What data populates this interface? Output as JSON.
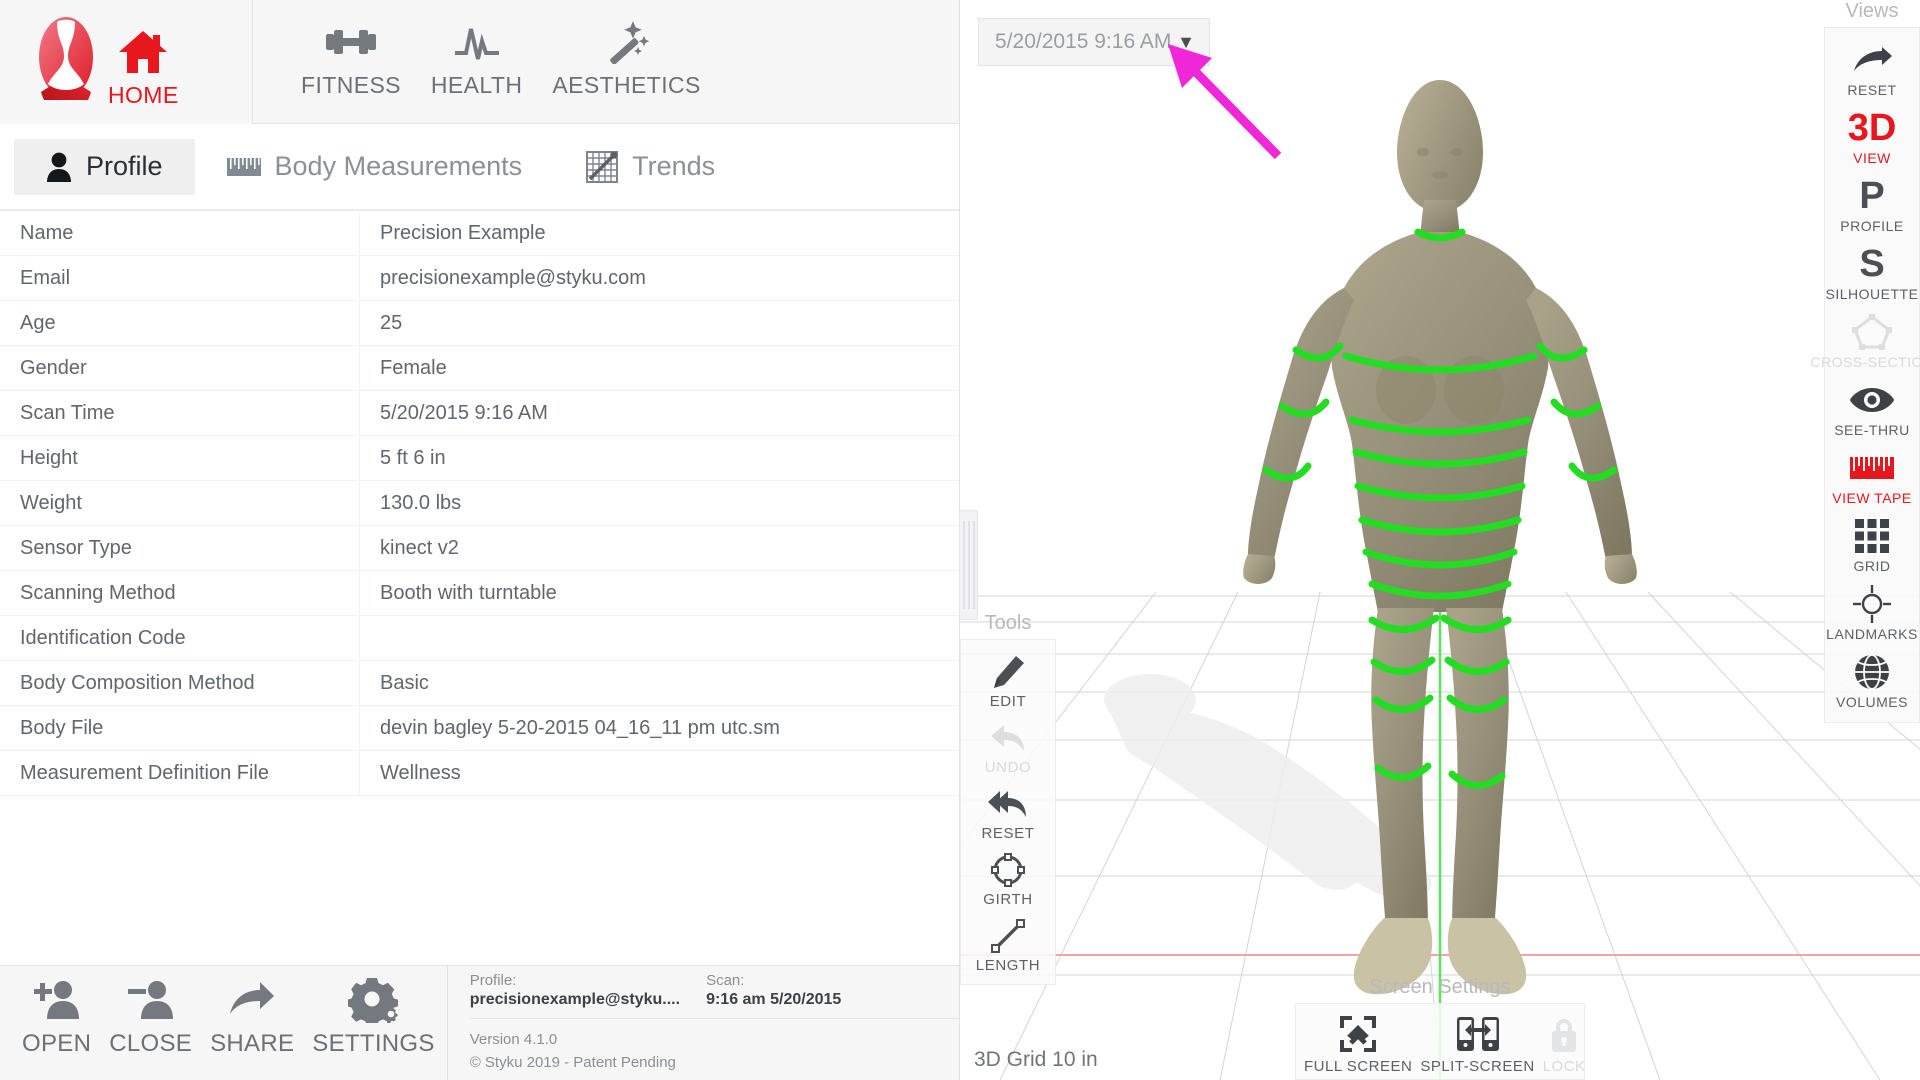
{
  "header": {
    "brand_name": "Styku",
    "logo_icon": "styku-logo-icon",
    "nav": [
      {
        "label": "HOME",
        "icon": "home-icon",
        "active": true
      },
      {
        "label": "FITNESS",
        "icon": "dumbbell-icon",
        "active": false
      },
      {
        "label": "HEALTH",
        "icon": "heartbeat-icon",
        "active": false
      },
      {
        "label": "AESTHETICS",
        "icon": "magic-wand-icon",
        "active": false
      }
    ]
  },
  "tabs": [
    {
      "label": "Profile",
      "icon": "person-icon",
      "active": true
    },
    {
      "label": "Body Measurements",
      "icon": "tape-measure-icon",
      "active": false
    },
    {
      "label": "Trends",
      "icon": "chart-trend-icon",
      "active": false
    }
  ],
  "profile": {
    "rows": [
      {
        "key": "Name",
        "value": "Precision Example"
      },
      {
        "key": "Email",
        "value": "precisionexample@styku.com"
      },
      {
        "key": "Age",
        "value": "25"
      },
      {
        "key": "Gender",
        "value": "Female"
      },
      {
        "key": "Scan Time",
        "value": "5/20/2015 9:16 AM"
      },
      {
        "key": "Height",
        "value": "5 ft 6 in"
      },
      {
        "key": "Weight",
        "value": "130.0 lbs"
      },
      {
        "key": "Sensor Type",
        "value": "kinect v2"
      },
      {
        "key": "Scanning Method",
        "value": "Booth with turntable"
      },
      {
        "key": "Identification Code",
        "value": ""
      },
      {
        "key": "Body Composition Method",
        "value": "Basic"
      },
      {
        "key": "Body File",
        "value": "devin bagley 5-20-2015 04_16_11 pm utc.sm"
      },
      {
        "key": "Measurement Definition File",
        "value": "Wellness"
      }
    ]
  },
  "bottom_bar": {
    "actions": [
      {
        "label": "OPEN",
        "icon": "add-user-icon"
      },
      {
        "label": "CLOSE",
        "icon": "remove-user-icon"
      },
      {
        "label": "SHARE",
        "icon": "share-arrow-icon"
      },
      {
        "label": "SETTINGS",
        "icon": "gear-icon"
      }
    ],
    "profile_label": "Profile:",
    "profile_value": "precisionexample@styku....",
    "scan_label": "Scan:",
    "scan_value": "9:16 am 5/20/2015",
    "version": "Version 4.1.0",
    "copyright": "© Styku 2019 - Patent Pending"
  },
  "viewport": {
    "scan_selector": {
      "value": "5/20/2015 9:16 AM",
      "caret_icon": "chevron-down-icon"
    },
    "grid_label": "3D Grid 10 in",
    "cursor_icon": "mouse-pointer-arrow",
    "cursor_color": "#f026d9",
    "model": {
      "skin_color": "#97907c",
      "band_color": "#22dd22",
      "axis_color": "#53e053",
      "floor_line_color": "#f5a3a3"
    }
  },
  "tools_panel": {
    "title": "Tools",
    "items": [
      {
        "label": "EDIT",
        "icon": "pen-icon",
        "disabled": false
      },
      {
        "label": "UNDO",
        "icon": "undo-arrow-icon",
        "disabled": true
      },
      {
        "label": "RESET",
        "icon": "reset-double-arrow-icon",
        "disabled": false
      },
      {
        "label": "GIRTH",
        "icon": "girth-circle-icon",
        "disabled": false
      },
      {
        "label": "LENGTH",
        "icon": "length-line-icon",
        "disabled": false
      }
    ]
  },
  "views_panel": {
    "title": "Views",
    "items": [
      {
        "label": "RESET",
        "icon": "reset-arrow-icon",
        "accent": false,
        "disabled": false
      },
      {
        "label": "VIEW",
        "icon": "3d-text-icon",
        "glyph": "3D",
        "accent": true,
        "disabled": false
      },
      {
        "label": "PROFILE",
        "icon": "p-letter-icon",
        "glyph": "P",
        "accent": false,
        "disabled": false
      },
      {
        "label": "SILHOUETTE",
        "icon": "s-letter-icon",
        "glyph": "S",
        "accent": false,
        "disabled": false
      },
      {
        "label": "CROSS-SECTION",
        "icon": "pentagon-icon",
        "accent": false,
        "disabled": true
      },
      {
        "label": "SEE-THRU",
        "icon": "eye-icon",
        "accent": false,
        "disabled": false
      },
      {
        "label": "VIEW TAPE",
        "icon": "tape-measure-icon",
        "accent": true,
        "disabled": false
      },
      {
        "label": "GRID",
        "icon": "grid-squares-icon",
        "accent": false,
        "disabled": false
      },
      {
        "label": "LANDMARKS",
        "icon": "crosshair-icon",
        "accent": false,
        "disabled": false
      },
      {
        "label": "VOLUMES",
        "icon": "globe-icon",
        "accent": false,
        "disabled": false
      }
    ]
  },
  "screen_settings": {
    "title": "Screen Settings",
    "items": [
      {
        "label": "FULL SCREEN",
        "icon": "expand-arrows-icon",
        "disabled": false
      },
      {
        "label": "SPLIT-SCREEN",
        "icon": "split-screen-icon",
        "disabled": false
      },
      {
        "label": "LOCK",
        "icon": "lock-icon",
        "disabled": true
      }
    ]
  },
  "colors": {
    "accent_red": "#e8161d",
    "icon_gray": "#6b7177",
    "panel_bg": "#f6f6f7",
    "text_gray": "#60666c"
  }
}
